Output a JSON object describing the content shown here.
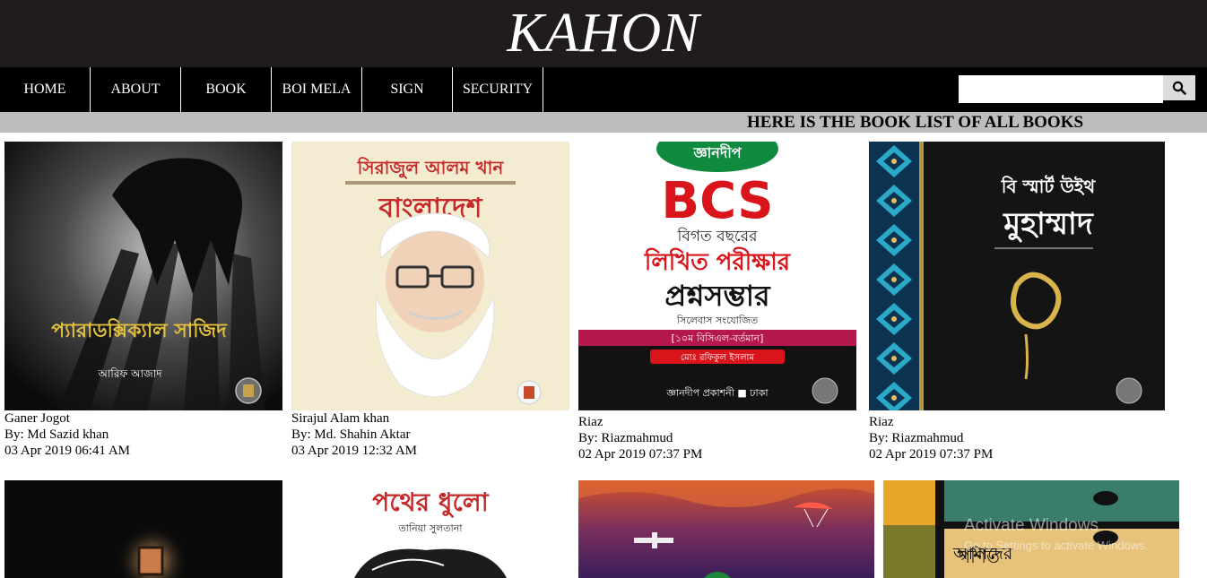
{
  "site": {
    "title": "KAHON"
  },
  "nav": {
    "items": [
      {
        "label": "HOME"
      },
      {
        "label": "ABOUT"
      },
      {
        "label": "BOOK"
      },
      {
        "label": "BOI MELA"
      },
      {
        "label": "SIGN"
      },
      {
        "label": "SECURITY"
      }
    ],
    "search": {
      "placeholder": "",
      "icon": "search-icon"
    }
  },
  "banner": {
    "text": "HERE IS THE BOOK LIST OF ALL BOOKS"
  },
  "books": [
    {
      "title": "Ganer Jogot",
      "author": "By: Md Sazid khan",
      "date": "03 Apr 2019 06:41 AM",
      "cover": {
        "main_text": "প্যারাডক্সিক্যাল সাজিদ",
        "sub_text": "আরিফ আজাদ"
      }
    },
    {
      "title": "Sirajul Alam khan",
      "author": "By: Md. Shahin Aktar",
      "date": "03 Apr 2019 12:32 AM",
      "cover": {
        "top_text": "সিরাজুল আলম খান",
        "main_text": "বাংলাদেশ"
      }
    },
    {
      "title": "Riaz",
      "author": "By: Riazmahmud",
      "date": "02 Apr 2019 07:37 PM",
      "cover": {
        "top_text": "জ্ঞানদীপ",
        "main_text": "BCS",
        "line2": "বিগত বছরের",
        "line3": "লিখিত পরীক্ষার",
        "line4": "প্রশ্নসম্ভার",
        "line5": "সিলেবাস সংযোজিত",
        "line6": "[১০ম বিসিএল-বর্তমান]",
        "line7": "মোঃ রফিকুল ইসলাম",
        "line8": "জ্ঞানদীপ প্রকাশনী ■ ঢাকা"
      }
    },
    {
      "title": "Riaz",
      "author": "By: Riazmahmud",
      "date": "02 Apr 2019 07:37 PM",
      "cover": {
        "top_text": "বি স্মার্ট উইথ",
        "main_text": "মুহাম্মাদ"
      }
    },
    {
      "cover": {
        "main_text": ""
      }
    },
    {
      "cover": {
        "main_text": "পথের ধুলো",
        "sub_text": "তানিয়া সুলতানা"
      }
    },
    {
      "cover": {
        "main_text": ""
      }
    },
    {
      "cover": {
        "main_text": "গণিত",
        "sub_text": "আমাদের"
      }
    }
  ],
  "system": {
    "watermark_title": "Activate Windows",
    "watermark_sub": "Go to Settings to activate Windows."
  },
  "colors": {
    "header_bg": "#201c1b",
    "nav_bg": "#000000",
    "banner_bg": "#bdbdbd"
  }
}
